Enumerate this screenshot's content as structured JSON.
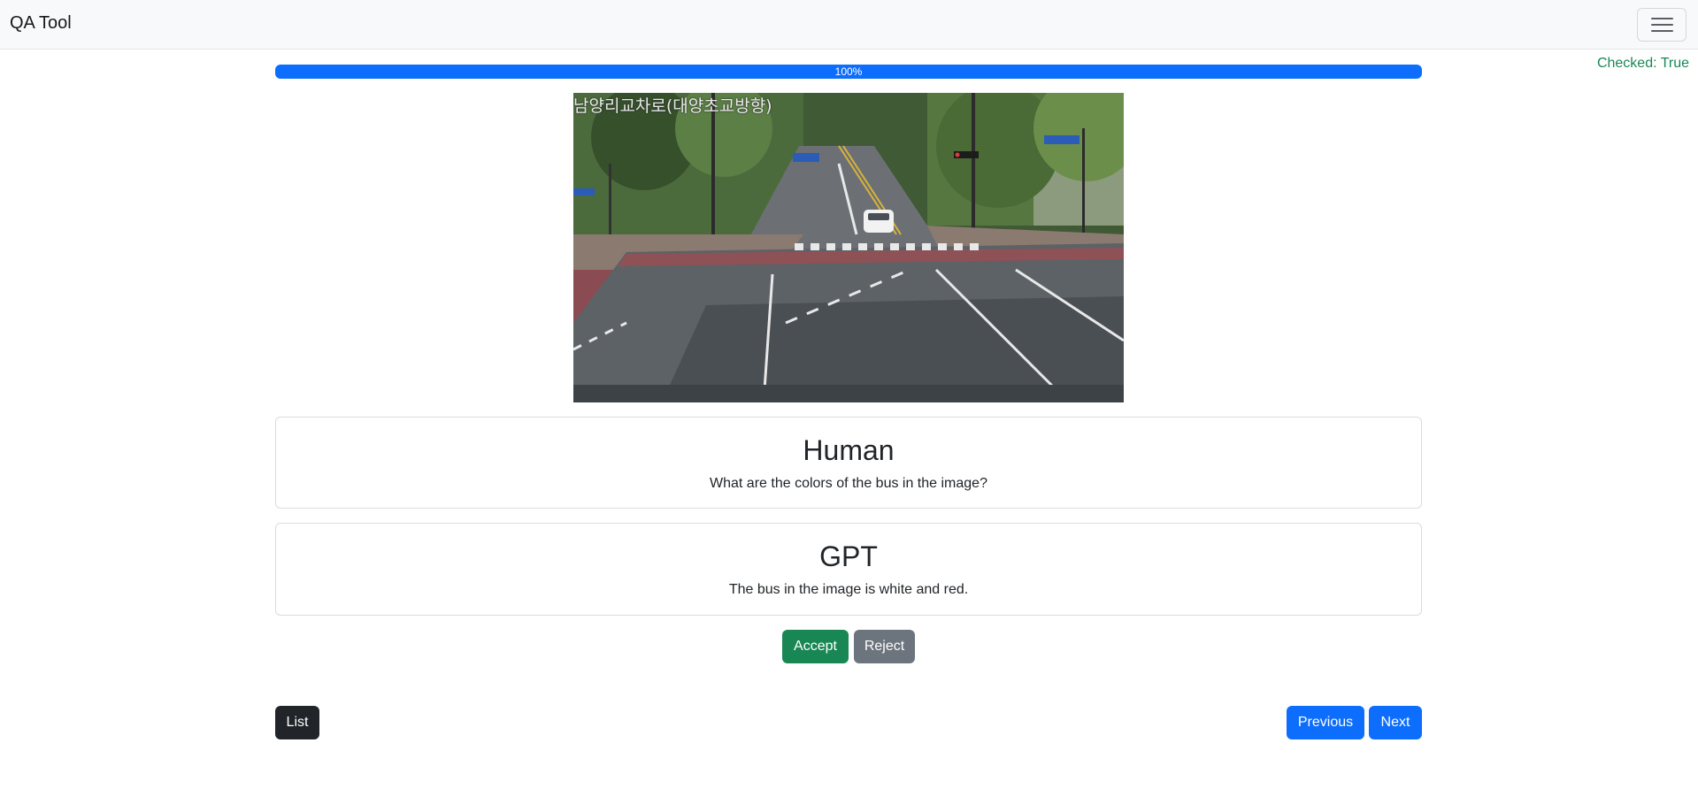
{
  "navbar": {
    "brand": "QA Tool",
    "toggler_icon": "hamburger-menu-icon"
  },
  "status": {
    "checked_text": "Checked: True"
  },
  "progress": {
    "value_percent": 100,
    "label": "100%"
  },
  "image": {
    "overlay_caption": "남양리교차로(대양초교방향)"
  },
  "human": {
    "title": "Human",
    "text": "What are the colors of the bus in the image?"
  },
  "gpt": {
    "title": "GPT",
    "text": "The bus in the image is white and red."
  },
  "actions": {
    "accept_label": "Accept",
    "reject_label": "Reject"
  },
  "navigation": {
    "list_label": "List",
    "previous_label": "Previous",
    "next_label": "Next"
  },
  "colors": {
    "primary": "#0d6efd",
    "success": "#198754",
    "secondary": "#6c757d",
    "dark": "#212529"
  }
}
